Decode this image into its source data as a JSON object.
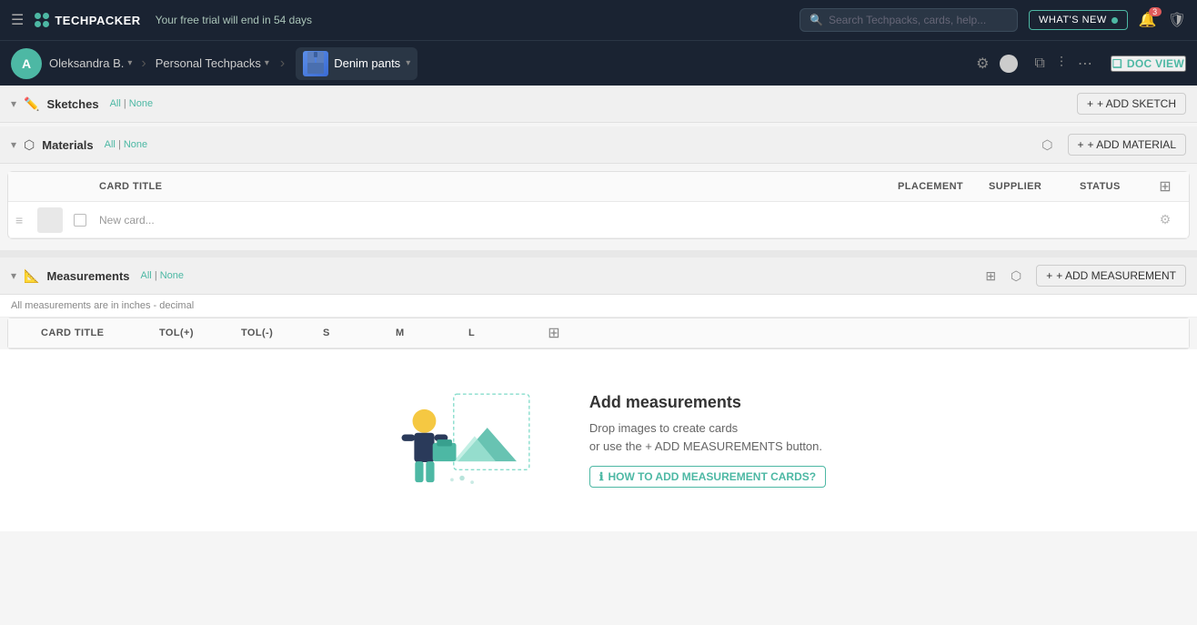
{
  "topNav": {
    "hamburger_label": "☰",
    "logo_text": "TECHPACKER",
    "trial_text": "Your free trial will end in 54 days",
    "search_placeholder": "Search Techpacks, cards, help...",
    "whats_new_label": "WHAT'S NEW",
    "bell_badge": "3",
    "workspace_name": "Oleksandra B.",
    "techpack_name": "Personal Techpacks",
    "product_name": "Denim pants",
    "doc_view_label": "DOC VIEW"
  },
  "sketches": {
    "title": "Sketches",
    "filter_all": "All",
    "filter_none": "None",
    "add_button": "+ ADD SKETCH"
  },
  "materials": {
    "title": "Materials",
    "filter_all": "All",
    "filter_none": "None",
    "add_button": "+ ADD MATERIAL",
    "table": {
      "columns": [
        {
          "id": "card_title",
          "label": "Card Title"
        },
        {
          "id": "placement",
          "label": "PLACEMENT"
        },
        {
          "id": "supplier",
          "label": "SUPPLIER"
        },
        {
          "id": "status",
          "label": "STATUS"
        }
      ],
      "rows": [
        {
          "name": "New card...",
          "placement": "",
          "supplier": "",
          "status": ""
        }
      ]
    }
  },
  "measurements": {
    "title": "Measurements",
    "filter_all": "All",
    "filter_none": "None",
    "add_button": "+ ADD MEASUREMENT",
    "info_text": "All measurements are in inches - decimal",
    "table": {
      "columns": [
        {
          "id": "card_title",
          "label": "Card Title"
        },
        {
          "id": "tol_plus",
          "label": "TOL(+)"
        },
        {
          "id": "tol_minus",
          "label": "TOL(-)"
        },
        {
          "id": "s",
          "label": "S"
        },
        {
          "id": "m",
          "label": "M"
        },
        {
          "id": "l",
          "label": "L"
        }
      ]
    },
    "empty_state": {
      "title": "Add measurements",
      "desc_line1": "Drop images to create cards",
      "desc_line2": "or use the + ADD MEASUREMENTS button.",
      "how_to_label": "HOW TO ADD MEASUREMENT CARDS?"
    }
  },
  "icons": {
    "hamburger": "☰",
    "search": "🔍",
    "bell": "🔔",
    "shield": "🛡",
    "columns": "⊞",
    "gear": "⚙",
    "drag": "≡",
    "chevron_down": "▾",
    "grid": "⊞",
    "export": "⬡",
    "plus": "+",
    "info": "ℹ",
    "copy": "⧉",
    "filter": "⫶",
    "more": "…",
    "layers": "❑"
  },
  "colors": {
    "accent": "#4db8a4",
    "nav_bg": "#1a2332",
    "text_primary": "#333",
    "text_muted": "#888"
  }
}
